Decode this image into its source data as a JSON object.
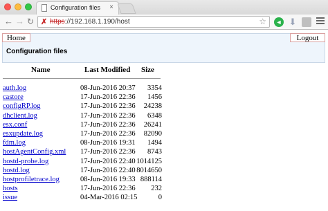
{
  "browser": {
    "tab_title": "Configuration files",
    "tab_close": "×",
    "url_scheme": "https",
    "url_rest": "://192.168.1.190/host"
  },
  "nav": {
    "home_label": "Home",
    "logout_label": "Logout"
  },
  "page": {
    "title": "Configuration files"
  },
  "table": {
    "headers": {
      "name": "Name",
      "modified": "Last Modified",
      "size": "Size"
    },
    "rows": [
      {
        "name": "auth.log",
        "modified": "08-Jun-2016 20:37",
        "size": "3354"
      },
      {
        "name": "castore",
        "modified": "17-Jun-2016 22:36",
        "size": "1456"
      },
      {
        "name": "configRP.log",
        "modified": "17-Jun-2016 22:36",
        "size": "24238"
      },
      {
        "name": "dhclient.log",
        "modified": "17-Jun-2016 22:36",
        "size": "6348"
      },
      {
        "name": "esx.conf",
        "modified": "17-Jun-2016 22:36",
        "size": "26241"
      },
      {
        "name": "esxupdate.log",
        "modified": "17-Jun-2016 22:36",
        "size": "82090"
      },
      {
        "name": "fdm.log",
        "modified": "08-Jun-2016 19:31",
        "size": "1494"
      },
      {
        "name": "hostAgentConfig.xml",
        "modified": "17-Jun-2016 22:36",
        "size": "8743"
      },
      {
        "name": "hostd-probe.log",
        "modified": "17-Jun-2016 22:40",
        "size": "1014125"
      },
      {
        "name": "hostd.log",
        "modified": "17-Jun-2016 22:40",
        "size": "8014650"
      },
      {
        "name": "hostprofiletrace.log",
        "modified": "08-Jun-2016 19:33",
        "size": "888114"
      },
      {
        "name": "hosts",
        "modified": "17-Jun-2016 22:36",
        "size": "232"
      },
      {
        "name": "issue",
        "modified": "04-Mar-2016 02:15",
        "size": "0"
      }
    ]
  }
}
